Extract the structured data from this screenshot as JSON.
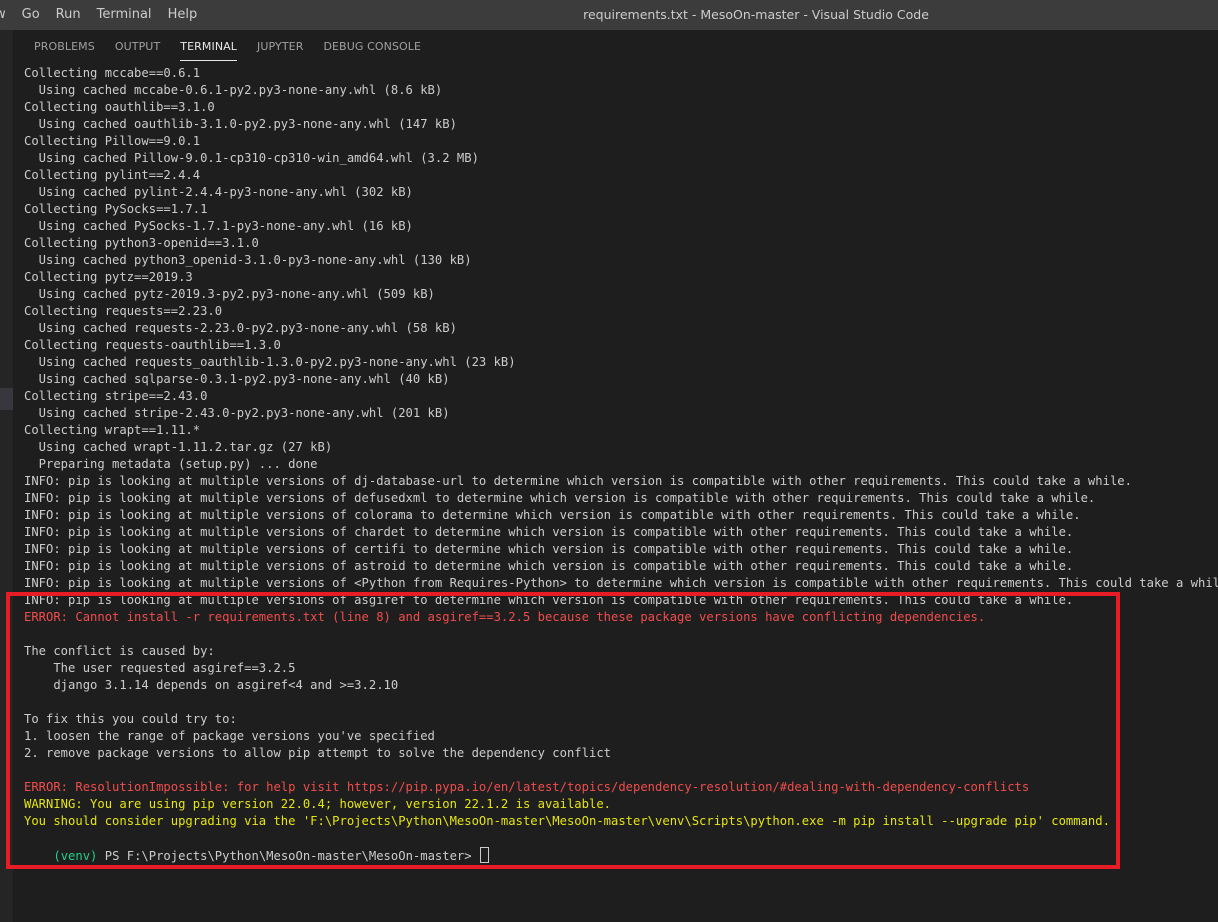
{
  "menubar": {
    "items": [
      "w",
      "Go",
      "Run",
      "Terminal",
      "Help"
    ]
  },
  "window": {
    "title": "requirements.txt - MesoOn-master - Visual Studio Code"
  },
  "panel": {
    "tabs": [
      {
        "label": "PROBLEMS",
        "active": false
      },
      {
        "label": "OUTPUT",
        "active": false
      },
      {
        "label": "TERMINAL",
        "active": true
      },
      {
        "label": "JUPYTER",
        "active": false
      },
      {
        "label": "DEBUG CONSOLE",
        "active": false
      }
    ]
  },
  "colors": {
    "error": "#f14c4c",
    "warning": "#e5e510",
    "venv": "#23d18b",
    "highlight_box": "#e81c24"
  },
  "terminal": {
    "lines": [
      {
        "text": "Collecting mccabe==0.6.1",
        "type": "normal"
      },
      {
        "text": "  Using cached mccabe-0.6.1-py2.py3-none-any.whl (8.6 kB)",
        "type": "normal"
      },
      {
        "text": "Collecting oauthlib==3.1.0",
        "type": "normal"
      },
      {
        "text": "  Using cached oauthlib-3.1.0-py2.py3-none-any.whl (147 kB)",
        "type": "normal"
      },
      {
        "text": "Collecting Pillow==9.0.1",
        "type": "normal"
      },
      {
        "text": "  Using cached Pillow-9.0.1-cp310-cp310-win_amd64.whl (3.2 MB)",
        "type": "normal"
      },
      {
        "text": "Collecting pylint==2.4.4",
        "type": "normal"
      },
      {
        "text": "  Using cached pylint-2.4.4-py3-none-any.whl (302 kB)",
        "type": "normal"
      },
      {
        "text": "Collecting PySocks==1.7.1",
        "type": "normal"
      },
      {
        "text": "  Using cached PySocks-1.7.1-py3-none-any.whl (16 kB)",
        "type": "normal"
      },
      {
        "text": "Collecting python3-openid==3.1.0",
        "type": "normal"
      },
      {
        "text": "  Using cached python3_openid-3.1.0-py3-none-any.whl (130 kB)",
        "type": "normal"
      },
      {
        "text": "Collecting pytz==2019.3",
        "type": "normal"
      },
      {
        "text": "  Using cached pytz-2019.3-py2.py3-none-any.whl (509 kB)",
        "type": "normal"
      },
      {
        "text": "Collecting requests==2.23.0",
        "type": "normal"
      },
      {
        "text": "  Using cached requests-2.23.0-py2.py3-none-any.whl (58 kB)",
        "type": "normal"
      },
      {
        "text": "Collecting requests-oauthlib==1.3.0",
        "type": "normal"
      },
      {
        "text": "  Using cached requests_oauthlib-1.3.0-py2.py3-none-any.whl (23 kB)",
        "type": "normal"
      },
      {
        "text": "  Using cached sqlparse-0.3.1-py2.py3-none-any.whl (40 kB)",
        "type": "normal"
      },
      {
        "text": "Collecting stripe==2.43.0",
        "type": "normal"
      },
      {
        "text": "  Using cached stripe-2.43.0-py2.py3-none-any.whl (201 kB)",
        "type": "normal"
      },
      {
        "text": "Collecting wrapt==1.11.*",
        "type": "normal"
      },
      {
        "text": "  Using cached wrapt-1.11.2.tar.gz (27 kB)",
        "type": "normal"
      },
      {
        "text": "  Preparing metadata (setup.py) ... done",
        "type": "normal"
      },
      {
        "text": "INFO: pip is looking at multiple versions of dj-database-url to determine which version is compatible with other requirements. This could take a while.",
        "type": "normal"
      },
      {
        "text": "INFO: pip is looking at multiple versions of defusedxml to determine which version is compatible with other requirements. This could take a while.",
        "type": "normal"
      },
      {
        "text": "INFO: pip is looking at multiple versions of colorama to determine which version is compatible with other requirements. This could take a while.",
        "type": "normal"
      },
      {
        "text": "INFO: pip is looking at multiple versions of chardet to determine which version is compatible with other requirements. This could take a while.",
        "type": "normal"
      },
      {
        "text": "INFO: pip is looking at multiple versions of certifi to determine which version is compatible with other requirements. This could take a while.",
        "type": "normal"
      },
      {
        "text": "INFO: pip is looking at multiple versions of astroid to determine which version is compatible with other requirements. This could take a while.",
        "type": "normal"
      },
      {
        "text": "INFO: pip is looking at multiple versions of <Python from Requires-Python> to determine which version is compatible with other requirements. This could take a while.",
        "type": "normal"
      },
      {
        "text": "INFO: pip is looking at multiple versions of asgiref to determine which version is compatible with other requirements. This could take a while.",
        "type": "normal"
      },
      {
        "text": "ERROR: Cannot install -r requirements.txt (line 8) and asgiref==3.2.5 because these package versions have conflicting dependencies.",
        "type": "err"
      },
      {
        "text": "",
        "type": "normal"
      },
      {
        "text": "The conflict is caused by:",
        "type": "normal"
      },
      {
        "text": "    The user requested asgiref==3.2.5",
        "type": "normal"
      },
      {
        "text": "    django 3.1.14 depends on asgiref<4 and >=3.2.10",
        "type": "normal"
      },
      {
        "text": "",
        "type": "normal"
      },
      {
        "text": "To fix this you could try to:",
        "type": "normal"
      },
      {
        "text": "1. loosen the range of package versions you've specified",
        "type": "normal"
      },
      {
        "text": "2. remove package versions to allow pip attempt to solve the dependency conflict",
        "type": "normal"
      },
      {
        "text": "",
        "type": "normal"
      },
      {
        "text": "ERROR: ResolutionImpossible: for help visit https://pip.pypa.io/en/latest/topics/dependency-resolution/#dealing-with-dependency-conflicts",
        "type": "err"
      },
      {
        "text": "WARNING: You are using pip version 22.0.4; however, version 22.1.2 is available.",
        "type": "warn"
      },
      {
        "text": "You should consider upgrading via the 'F:\\Projects\\Python\\MesoOn-master\\MesoOn-master\\venv\\Scripts\\python.exe -m pip install --upgrade pip' command.",
        "type": "warn"
      }
    ],
    "prompt": {
      "venv": "(venv)",
      "text": " PS F:\\Projects\\Python\\MesoOn-master\\MesoOn-master> "
    }
  }
}
